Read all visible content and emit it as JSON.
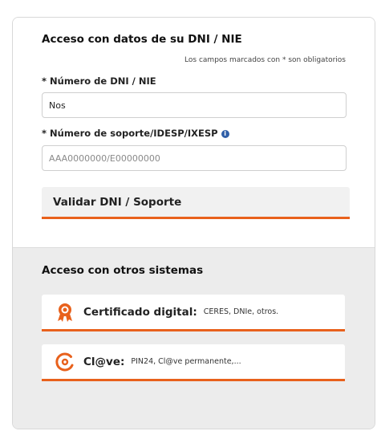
{
  "dni_section": {
    "title": "Acceso con datos de su DNI / NIE",
    "required_note": "Los campos marcados con * son obligatorios",
    "dni_field": {
      "label": "* Número de DNI / NIE",
      "value": "Nos"
    },
    "support_field": {
      "label": "* Número de soporte/IDESP/IXESP",
      "placeholder": "AAA0000000/E00000000",
      "info_icon": "info-icon"
    },
    "validate_button": "Validar DNI / Soporte"
  },
  "other_section": {
    "title": "Acceso con otros sistemas",
    "options": [
      {
        "label": "Certificado digital:",
        "detail": "CERES, DNIe, otros.",
        "icon": "certificate-badge-icon"
      },
      {
        "label": "Cl@ve:",
        "detail": "PIN24, Cl@ve permanente,...",
        "icon": "clave-icon"
      }
    ]
  },
  "colors": {
    "accent": "#e8611c",
    "info": "#2f5fa8",
    "bottom_background": "#ececec"
  }
}
